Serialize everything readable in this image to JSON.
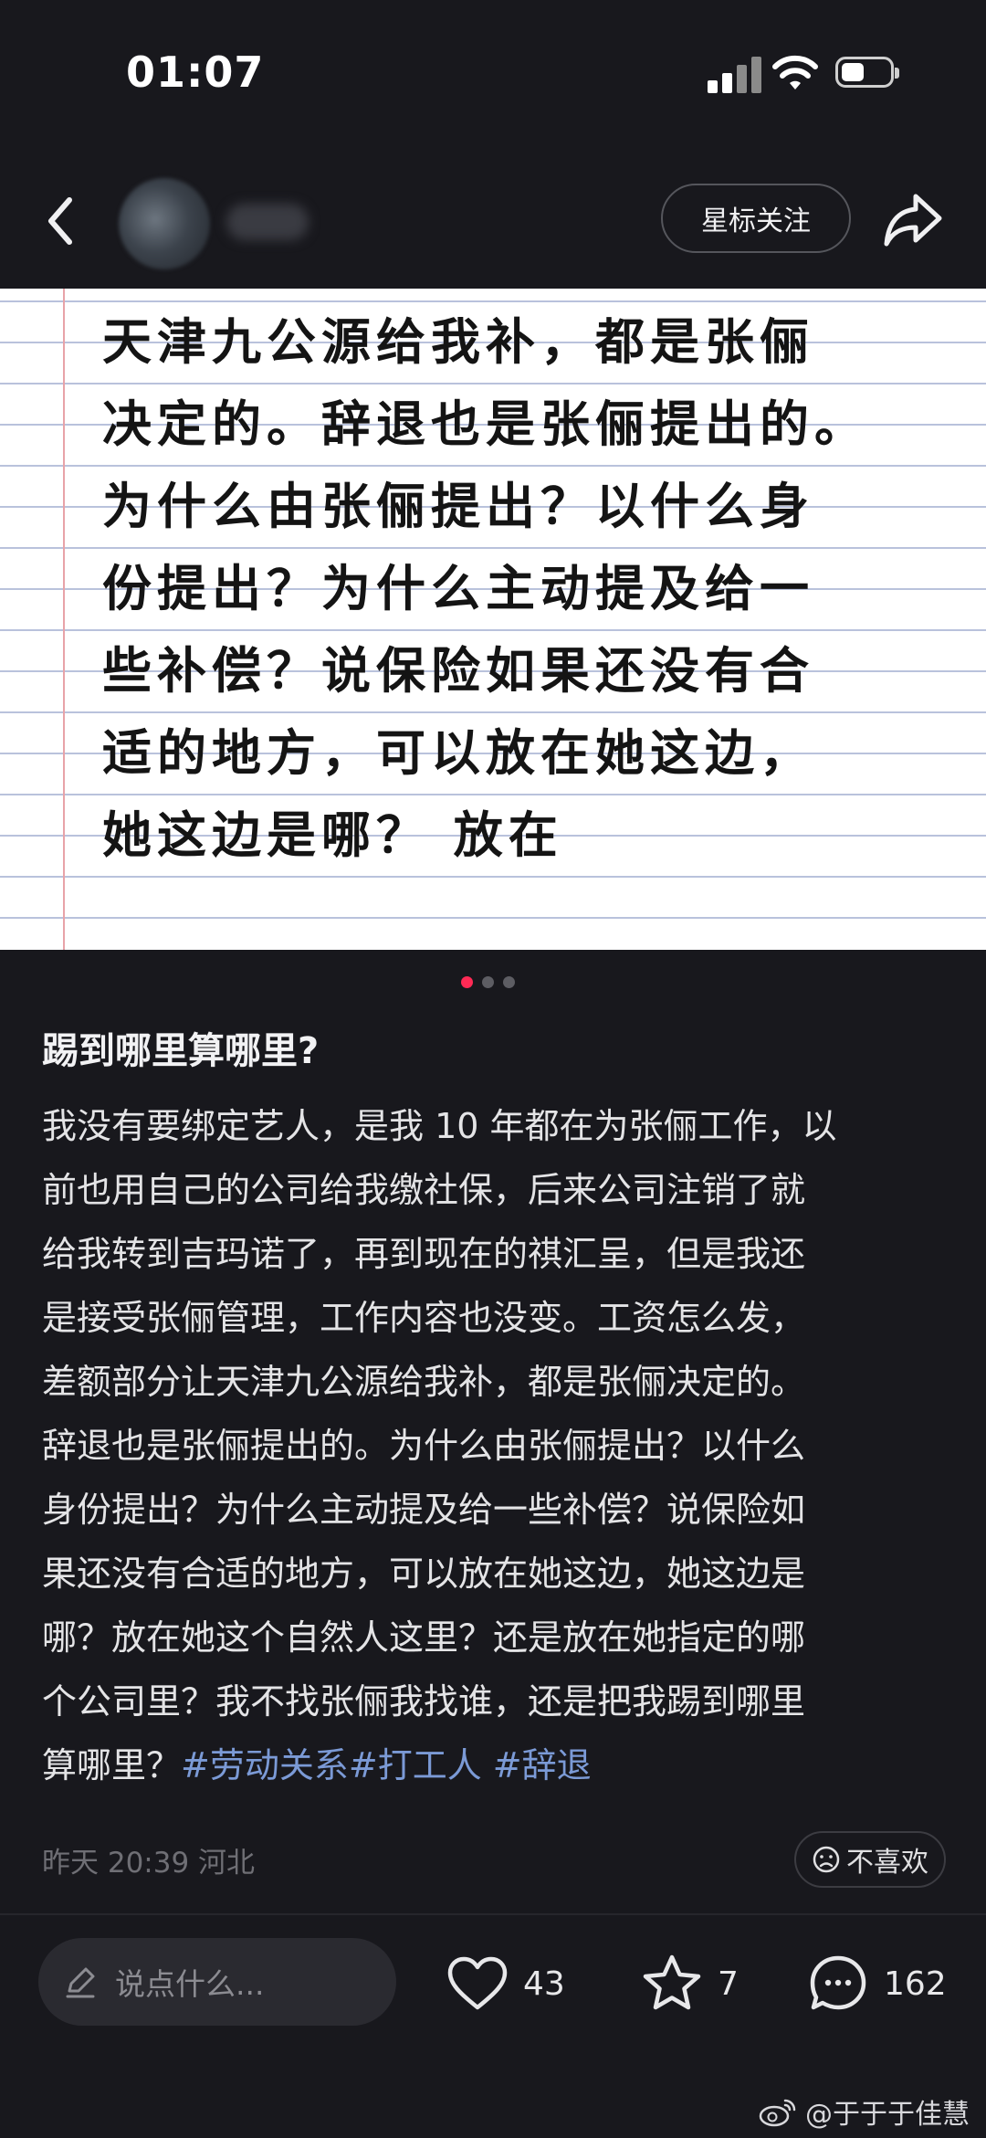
{
  "status_bar": {
    "time": "01:07"
  },
  "header": {
    "follow_label": "星标关注"
  },
  "note_image": {
    "lines": [
      "天津九公源给我补，都是张俪",
      "决定的。辞退也是张俪提出的。",
      "为什么由张俪提出？以什么身",
      "份提出？为什么主动提及给一",
      "些补偿？说保险如果还没有合",
      "适的地方，可以放在她这边，",
      "她这边是哪？ 放在"
    ],
    "page_count": 3,
    "active_page": 1
  },
  "post": {
    "title": "踢到哪里算哪里?",
    "body_lines": [
      "我没有要绑定艺人，是我 10 年都在为张俪工作，以",
      "前也用自己的公司给我缴社保，后来公司注销了就",
      "给我转到吉玛诺了，再到现在的祺汇呈，但是我还",
      "是接受张俪管理，工作内容也没变。工资怎么发，",
      "差额部分让天津九公源给我补，都是张俪决定的。",
      "辞退也是张俪提出的。为什么由张俪提出？以什么",
      "身份提出？为什么主动提及给一些补偿？说保险如",
      "果还没有合适的地方，可以放在她这边，她这边是",
      "哪？放在她这个自然人这里？还是放在她指定的哪",
      "个公司里？我不找张俪我找谁，还是把我踢到哪里"
    ],
    "last_line_text": "算哪里？",
    "tags": [
      "#劳动关系",
      "#打工人",
      "#辞退"
    ],
    "meta": "昨天 20:39 河北",
    "dislike_label": "不喜欢"
  },
  "bottom_bar": {
    "comment_placeholder": "说点什么...",
    "likes": "43",
    "favorites": "7",
    "comments": "162"
  },
  "watermark": "@于于于佳慧",
  "colors": {
    "background": "#18181d",
    "accent_dot": "#ff2a55",
    "tag": "#7b9ad6"
  }
}
